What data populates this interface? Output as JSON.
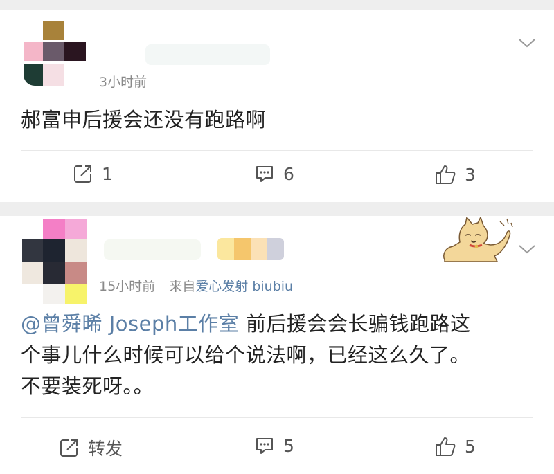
{
  "post1": {
    "timestamp": "3小时前",
    "text": "郝富申后援会还没有跑路啊",
    "actions": {
      "repost_count": "1",
      "comment_count": "6",
      "like_count": "3"
    }
  },
  "post2": {
    "timestamp": "15小时前",
    "source_prefix": "来自",
    "source_name": "爱心发射 biubiu",
    "mention": "@曾舜晞 Joseph工作室",
    "text_line1_rest": " 前后援会会长骗钱跑路这",
    "text_line2": "个事儿什么时候可以给个说法啊，已经这么久了。",
    "text_line3": "不要装死呀。。",
    "actions": {
      "repost_label": "转发",
      "comment_count": "5",
      "like_count": "5"
    }
  },
  "icons": {
    "repost": "repost-icon",
    "comment": "comment-icon",
    "like": "thumbs-up-icon",
    "more": "chevron-down-icon",
    "sticker": "dog-sticker-icon"
  },
  "colors": {
    "link": "#5b7fa6",
    "meta": "#8a8a8a",
    "text": "#222222",
    "background": "#eeeeee"
  }
}
